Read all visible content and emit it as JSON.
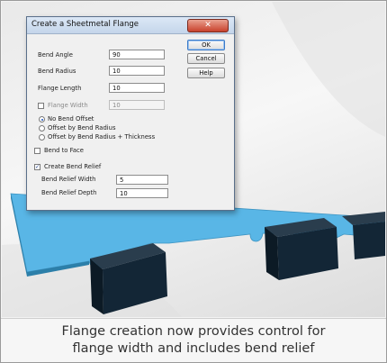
{
  "dialog": {
    "title": "Create a Sheetmetal Flange",
    "close_glyph": "✕",
    "fields": {
      "bend_angle": {
        "label": "Bend Angle",
        "value": "90"
      },
      "bend_radius": {
        "label": "Bend Radius",
        "value": "10"
      },
      "flange_length": {
        "label": "Flange Length",
        "value": "10"
      },
      "flange_width": {
        "label": "Flange Width",
        "value": "10"
      }
    },
    "buttons": {
      "ok": "OK",
      "cancel": "Cancel",
      "help": "Help"
    },
    "offset_options": [
      "No Bend Offset",
      "Offset by Bend Radius",
      "Offset by Bend Radius + Thickness"
    ],
    "selected_offset": "No Bend Offset",
    "bend_to_face": "Bend to Face",
    "create_bend_relief": "Create Bend Relief",
    "bend_relief_width": {
      "label": "Bend Relief Width",
      "value": "5"
    },
    "bend_relief_depth": {
      "label": "Bend Relief Depth",
      "value": "10"
    },
    "checkbox_states": {
      "flange_width": false,
      "bend_to_face": false,
      "create_bend_relief": true
    },
    "check_glyph": "✓"
  },
  "caption": {
    "line1": "Flange creation now provides control for",
    "line2": "flange width and includes bend relief"
  },
  "colors": {
    "sheet": "#59b6e6",
    "sheet_edge": "#2c7fa9",
    "flange": "#132636"
  }
}
